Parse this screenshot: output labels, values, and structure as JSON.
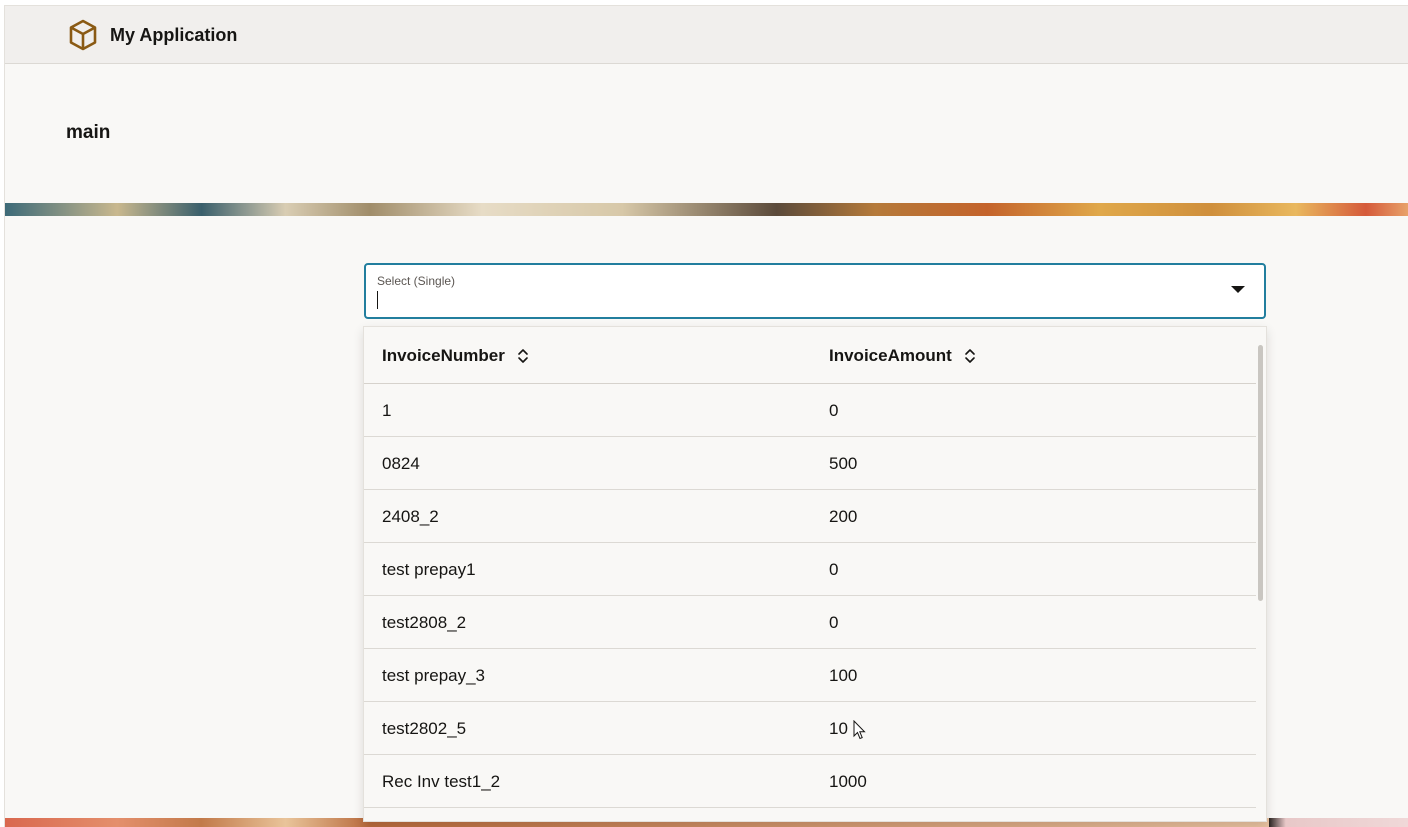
{
  "header": {
    "app_title": "My Application",
    "logo_icon": "cube-icon"
  },
  "page": {
    "title": "main"
  },
  "select": {
    "label": "Select (Single)",
    "value": "",
    "arrow_icon": "caret-down-icon"
  },
  "table": {
    "columns": [
      {
        "label": "InvoiceNumber",
        "sort_icon": "sort-icon"
      },
      {
        "label": "InvoiceAmount",
        "sort_icon": "sort-icon"
      }
    ],
    "rows": [
      {
        "invoice_number": "1",
        "invoice_amount": "0"
      },
      {
        "invoice_number": "0824",
        "invoice_amount": "500"
      },
      {
        "invoice_number": "2408_2",
        "invoice_amount": "200"
      },
      {
        "invoice_number": "test prepay1",
        "invoice_amount": "0"
      },
      {
        "invoice_number": "test2808_2",
        "invoice_amount": "0"
      },
      {
        "invoice_number": "test prepay_3",
        "invoice_amount": "100"
      },
      {
        "invoice_number": "test2802_5",
        "invoice_amount": "10"
      },
      {
        "invoice_number": "Rec Inv test1_2",
        "invoice_amount": "1000"
      }
    ]
  },
  "colors": {
    "accent": "#227e9e",
    "header_bg": "#f1efed",
    "page_bg": "#f9f8f6",
    "logo": "#8a5a14"
  }
}
